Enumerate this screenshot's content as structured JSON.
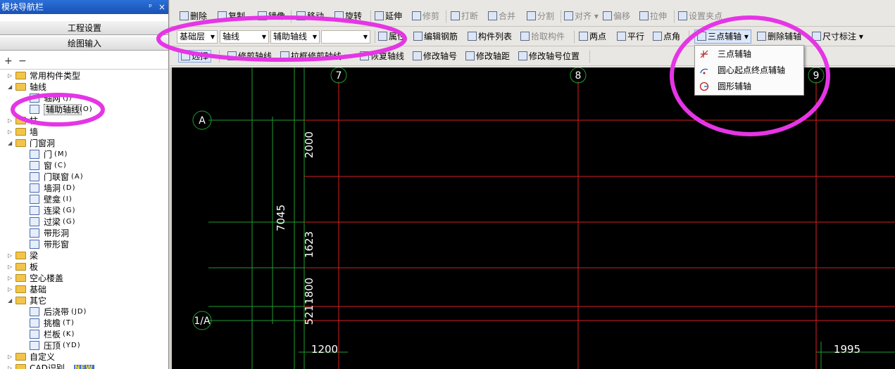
{
  "nav": {
    "title": "模块导航栏",
    "pin_glyph": "ᵖ",
    "close_glyph": "×",
    "tab_settings": "工程设置",
    "tab_drawing": "绘图输入",
    "expand_all_glyph": "+",
    "collapse_all_glyph": "−",
    "tree": [
      {
        "label": "常用构件类型",
        "count": "",
        "kind": "folder",
        "level": 0,
        "expander": "▷"
      },
      {
        "label": "轴线",
        "count": "",
        "kind": "folder",
        "level": 0,
        "expander": "◢"
      },
      {
        "label": "轴网",
        "count": "(J)",
        "kind": "item",
        "level": 1,
        "expander": ""
      },
      {
        "label": "辅助轴线",
        "count": "(O)",
        "kind": "item",
        "level": 1,
        "expander": ""
      },
      {
        "label": "柱",
        "count": "",
        "kind": "folder",
        "level": 0,
        "expander": "▷"
      },
      {
        "label": "墙",
        "count": "",
        "kind": "folder",
        "level": 0,
        "expander": "▷"
      },
      {
        "label": "门窗洞",
        "count": "",
        "kind": "folder",
        "level": 0,
        "expander": "◢"
      },
      {
        "label": "门",
        "count": "(M)",
        "kind": "item",
        "level": 1,
        "expander": ""
      },
      {
        "label": "窗",
        "count": "(C)",
        "kind": "item",
        "level": 1,
        "expander": ""
      },
      {
        "label": "门联窗",
        "count": "(A)",
        "kind": "item",
        "level": 1,
        "expander": ""
      },
      {
        "label": "墙洞",
        "count": "(D)",
        "kind": "item",
        "level": 1,
        "expander": ""
      },
      {
        "label": "壁龛",
        "count": "(I)",
        "kind": "item",
        "level": 1,
        "expander": ""
      },
      {
        "label": "连梁",
        "count": "(G)",
        "kind": "item",
        "level": 1,
        "expander": ""
      },
      {
        "label": "过梁",
        "count": "(G)",
        "kind": "item",
        "level": 1,
        "expander": ""
      },
      {
        "label": "带形洞",
        "count": "",
        "kind": "item",
        "level": 1,
        "expander": ""
      },
      {
        "label": "带形窗",
        "count": "",
        "kind": "item",
        "level": 1,
        "expander": ""
      },
      {
        "label": "梁",
        "count": "",
        "kind": "folder",
        "level": 0,
        "expander": "▷"
      },
      {
        "label": "板",
        "count": "",
        "kind": "folder",
        "level": 0,
        "expander": "▷"
      },
      {
        "label": "空心楼盖",
        "count": "",
        "kind": "folder",
        "level": 0,
        "expander": "▷"
      },
      {
        "label": "基础",
        "count": "",
        "kind": "folder",
        "level": 0,
        "expander": "▷"
      },
      {
        "label": "其它",
        "count": "",
        "kind": "folder",
        "level": 0,
        "expander": "◢"
      },
      {
        "label": "后浇带",
        "count": "(JD)",
        "kind": "item",
        "level": 1,
        "expander": ""
      },
      {
        "label": "挑檐",
        "count": "(T)",
        "kind": "item",
        "level": 1,
        "expander": ""
      },
      {
        "label": "栏板",
        "count": "(K)",
        "kind": "item",
        "level": 1,
        "expander": ""
      },
      {
        "label": "压顶",
        "count": "(YD)",
        "kind": "item",
        "level": 1,
        "expander": ""
      },
      {
        "label": "自定义",
        "count": "",
        "kind": "folder",
        "level": 0,
        "expander": "▷"
      },
      {
        "label": "CAD识别",
        "count": "NEW",
        "kind": "folder",
        "level": 0,
        "expander": "▷"
      }
    ]
  },
  "toolbar1": {
    "items": [
      {
        "label": "删除",
        "disabled": false
      },
      {
        "label": "复制",
        "disabled": false
      },
      {
        "label": "镜像",
        "disabled": false
      },
      {
        "label": "移动",
        "disabled": false
      },
      {
        "label": "旋转",
        "disabled": false
      },
      {
        "label": "延伸",
        "disabled": false
      },
      {
        "label": "修剪",
        "disabled": true
      },
      {
        "label": "打断",
        "disabled": true
      },
      {
        "label": "合并",
        "disabled": true
      },
      {
        "label": "分割",
        "disabled": true
      },
      {
        "label": "对齐",
        "disabled": true
      },
      {
        "label": "偏移",
        "disabled": true
      },
      {
        "label": "拉伸",
        "disabled": true
      },
      {
        "label": "设置夹点",
        "disabled": true
      }
    ]
  },
  "toolbar2": {
    "floor_combo": "基础层",
    "category_combo": "轴线",
    "type_combo": "辅助轴线",
    "name_combo": "",
    "properties": "属性",
    "edit_rebar": "编辑钢筋",
    "component_list": "构件列表",
    "pick_component": "拾取构件",
    "two_point": "两点",
    "parallel": "平行",
    "point_angle": "点角",
    "three_point_aux": "三点辅轴",
    "delete_aux": "删除辅轴",
    "dimension": "尺寸标注"
  },
  "toolbar3": {
    "select": "选择",
    "trim_axis": "修剪轴线",
    "box_trim_axis": "拉框修剪轴线",
    "restore_axis": "恢复轴线",
    "modify_axis_no": "修改轴号",
    "modify_axis_dist": "修改轴距",
    "modify_axis_pos": "修改轴号位置"
  },
  "aux_menu": {
    "items": [
      {
        "label": "三点辅轴"
      },
      {
        "label": "圆心起点终点辅轴"
      },
      {
        "label": "圆形辅轴"
      }
    ]
  },
  "canvas": {
    "axis_labels": {
      "col7": "7",
      "col8": "8",
      "col9": "9",
      "rowA": "A",
      "row1A": "1/A"
    },
    "dims": {
      "d2000": "2000",
      "d7045": "7045",
      "d1623": "1623",
      "d1800": "1800",
      "d521": "521",
      "d1200": "1200",
      "d1995": "1995"
    }
  },
  "colors": {
    "canvas_bg": "#000000",
    "grid_green": "#1f9e2f",
    "axis_red": "#d82020",
    "text_white": "#ffffff",
    "highlight_magenta": "#e535e5",
    "nav_header_blue": "#1a52b5"
  }
}
